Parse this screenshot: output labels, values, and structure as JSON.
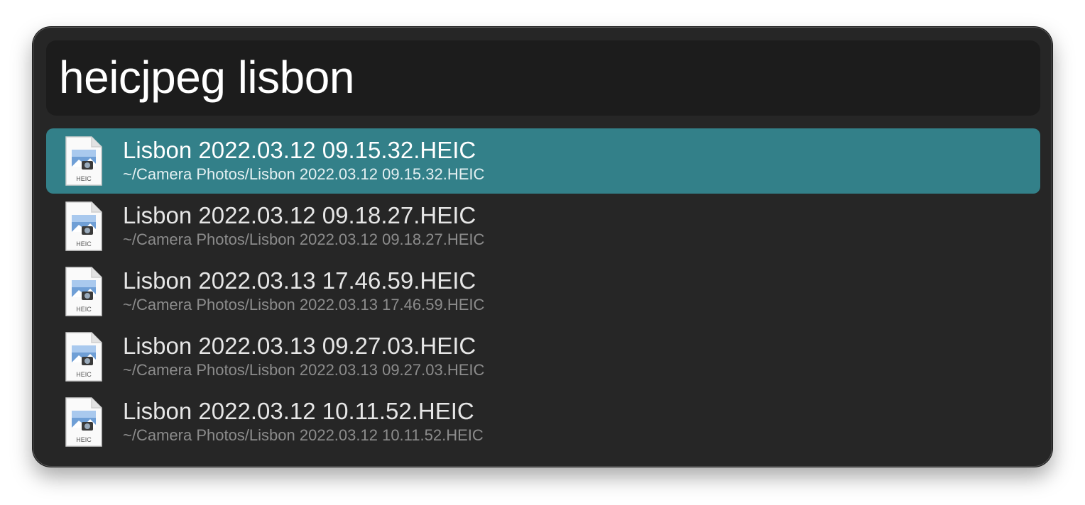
{
  "search": {
    "query": "heicjpeg lisbon"
  },
  "results": [
    {
      "title": "Lisbon 2022.03.12 09.15.32.HEIC",
      "path": "~/Camera Photos/Lisbon 2022.03.12 09.15.32.HEIC",
      "icon": "heic-file-icon",
      "icon_label": "HEIC",
      "selected": true
    },
    {
      "title": "Lisbon 2022.03.12 09.18.27.HEIC",
      "path": "~/Camera Photos/Lisbon 2022.03.12 09.18.27.HEIC",
      "icon": "heic-file-icon",
      "icon_label": "HEIC",
      "selected": false
    },
    {
      "title": "Lisbon 2022.03.13 17.46.59.HEIC",
      "path": "~/Camera Photos/Lisbon 2022.03.13 17.46.59.HEIC",
      "icon": "heic-file-icon",
      "icon_label": "HEIC",
      "selected": false
    },
    {
      "title": "Lisbon 2022.03.13 09.27.03.HEIC",
      "path": "~/Camera Photos/Lisbon 2022.03.13 09.27.03.HEIC",
      "icon": "heic-file-icon",
      "icon_label": "HEIC",
      "selected": false
    },
    {
      "title": "Lisbon 2022.03.12 10.11.52.HEIC",
      "path": "~/Camera Photos/Lisbon 2022.03.12 10.11.52.HEIC",
      "icon": "heic-file-icon",
      "icon_label": "HEIC",
      "selected": false
    }
  ],
  "colors": {
    "window_background": "#262626",
    "search_background": "#1c1c1c",
    "selection_accent": "#338089"
  }
}
